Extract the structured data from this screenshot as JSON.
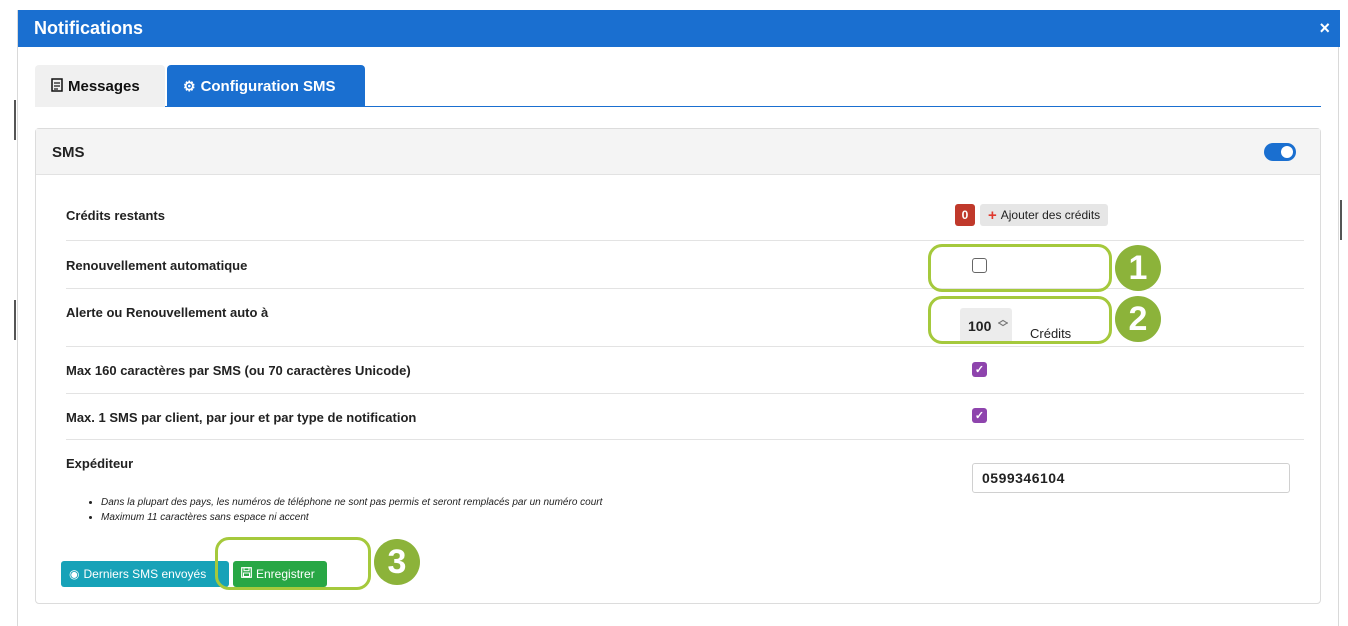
{
  "modal": {
    "title": "Notifications",
    "close_glyph": "×"
  },
  "tabs": [
    {
      "label": "Messages",
      "icon": "document-icon",
      "active": false
    },
    {
      "label": "Configuration SMS",
      "icon": "gear-icon",
      "active": true
    }
  ],
  "card": {
    "title": "SMS",
    "enabled": true
  },
  "rows": {
    "credits": {
      "label": "Crédits restants",
      "count": "0",
      "add_button": "Ajouter des crédits"
    },
    "auto_renew": {
      "label": "Renouvellement automatique",
      "checked": false
    },
    "alert": {
      "label": "Alerte ou Renouvellement auto à",
      "value": "100",
      "unit": "Crédits"
    },
    "max160": {
      "label": "Max 160 caractères par SMS (ou 70 caractères Unicode)",
      "checked": true
    },
    "max1": {
      "label": "Max. 1 SMS par client, par jour et par type de notification",
      "checked": true
    },
    "sender": {
      "label": "Expéditeur",
      "value": "0599346104",
      "notes": [
        "Dans la plupart des pays, les numéros de téléphone ne sont pas permis et seront remplacés par un numéro court",
        "Maximum 11 caractères sans espace ni accent"
      ]
    }
  },
  "buttons": {
    "history": "Derniers SMS envoyés",
    "save": "Enregistrer"
  },
  "callouts": [
    "1",
    "2",
    "3"
  ],
  "colors": {
    "primary": "#1a6fd0",
    "danger": "#c0392b",
    "checkbox": "#8e44ad",
    "info": "#17a2b8",
    "success": "#28a745",
    "highlight": "#a5c93c",
    "callout": "#8cb33a"
  }
}
